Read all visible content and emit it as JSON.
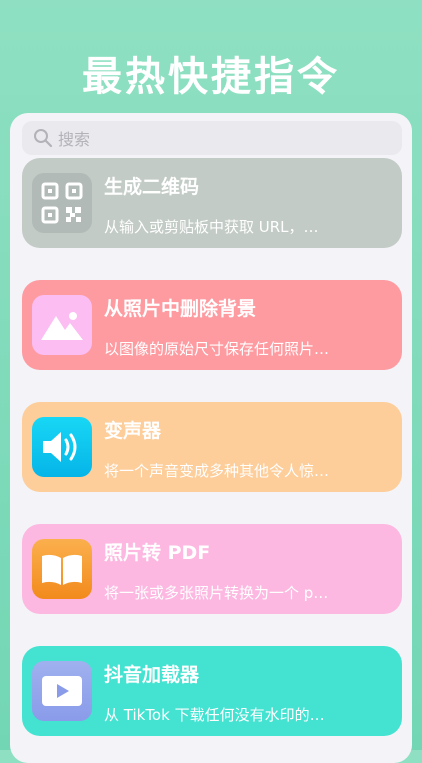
{
  "header": {
    "title": "最热快捷指令"
  },
  "search": {
    "placeholder": "搜索"
  },
  "shortcuts": [
    {
      "name": "生成二维码",
      "desc": "从输入或剪贴板中获取 URL，…",
      "icon": "qr-code-icon"
    },
    {
      "name": "从照片中删除背景",
      "desc": "以图像的原始尺寸保存任何照片…",
      "icon": "photo-mountain-icon"
    },
    {
      "name": "变声器",
      "desc": "将一个声音变成多种其他令人惊…",
      "icon": "speaker-icon"
    },
    {
      "name": "照片转 PDF",
      "desc": "将一张或多张照片转换为一个 p…",
      "icon": "book-icon"
    },
    {
      "name": "抖音加载器",
      "desc": "从 TikTok 下载任何没有水印的…",
      "icon": "video-play-icon"
    }
  ]
}
